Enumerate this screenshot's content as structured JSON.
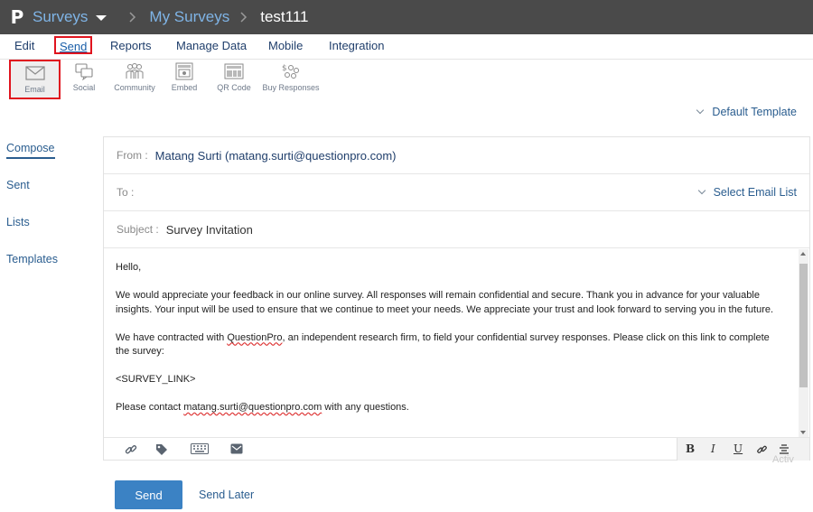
{
  "topbar": {
    "logo": "P",
    "surveys": "Surveys",
    "my_surveys": "My Surveys",
    "survey_name": "test111"
  },
  "main_nav": [
    "Edit",
    "Send",
    "Reports",
    "Manage Data",
    "Mobile",
    "Integration"
  ],
  "sub_nav": [
    "Email",
    "Social",
    "Community",
    "Embed",
    "QR Code",
    "Buy Responses"
  ],
  "template": "Default Template",
  "left_menu": [
    "Compose",
    "Sent",
    "Lists",
    "Templates"
  ],
  "compose": {
    "from_label": "From :",
    "from_value": "Matang Surti (matang.surti@questionpro.com)",
    "to_label": "To :",
    "select_list": "Select Email List",
    "subject_label": "Subject :",
    "subject_value": "Survey Invitation",
    "body": {
      "greeting": "Hello,",
      "p1": "We would appreciate your feedback in our online survey.  All responses will remain confidential and secure.  Thank you in advance for your valuable insights.  Your input will be used to ensure that we continue to meet your needs. We appreciate your trust and look forward to serving you in the future.",
      "p2_pre": "We have contracted with ",
      "p2_brand": "QuestionPro",
      "p2_post": ", an independent research firm, to field your confidential survey responses.  Please click on this link to complete the survey:",
      "link_tag": "<SURVEY_LINK>",
      "p4_pre": "Please contact ",
      "p4_email": "matang.surti@questionpro.com",
      "p4_post": " with any questions."
    },
    "format": [
      "B",
      "I",
      "U"
    ]
  },
  "watermark": "Activ",
  "actions": {
    "send": "Send",
    "send_later": "Send Later"
  },
  "colors": {
    "topbar": "#4a4a4a",
    "link": "#2a5d8f",
    "primary_button": "#3b82c4",
    "highlight_box": "#e0141e"
  }
}
